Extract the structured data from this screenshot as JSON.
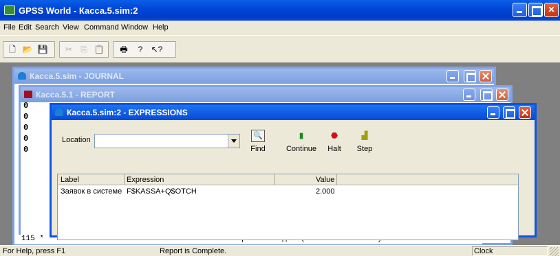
{
  "app": {
    "title": "GPSS World - Касса.5.sim:2"
  },
  "menu": [
    "File",
    "Edit",
    "Search",
    "View",
    "Command",
    "Window",
    "Help"
  ],
  "toolbar": {
    "icons": [
      "new-file-icon",
      "open-folder-icon",
      "save-icon",
      "cut-icon",
      "copy-icon",
      "paste-icon",
      "print-icon",
      "help-icon",
      "context-help-icon"
    ]
  },
  "windows": {
    "journal": {
      "title": "Касса.5.sim - JOURNAL"
    },
    "report": {
      "title": "Касса.5.1 - REPORT"
    },
    "journal_lines": [
      "0",
      "0",
      "0",
      "0",
      "0"
    ],
    "bottom_line_left": "115 *",
    "bottom_line_right": "рабочего дня (8 часов * 60 минут = 480 ми"
  },
  "expressions": {
    "title": "Касса.5.sim:2 - EXPRESSIONS",
    "location_label": "Location",
    "location_value": "",
    "buttons": {
      "find": "Find",
      "continue": "Continue",
      "halt": "Halt",
      "step": "Step"
    },
    "columns": [
      "Label",
      "Expression",
      "Value"
    ],
    "rows": [
      {
        "label": "Заявок в системе",
        "expression": "F$KASSA+Q$OTCH",
        "value": "2.000"
      }
    ]
  },
  "status": {
    "help": "For Help, press F1",
    "message": "Report is Complete.",
    "clock": "Clock"
  }
}
